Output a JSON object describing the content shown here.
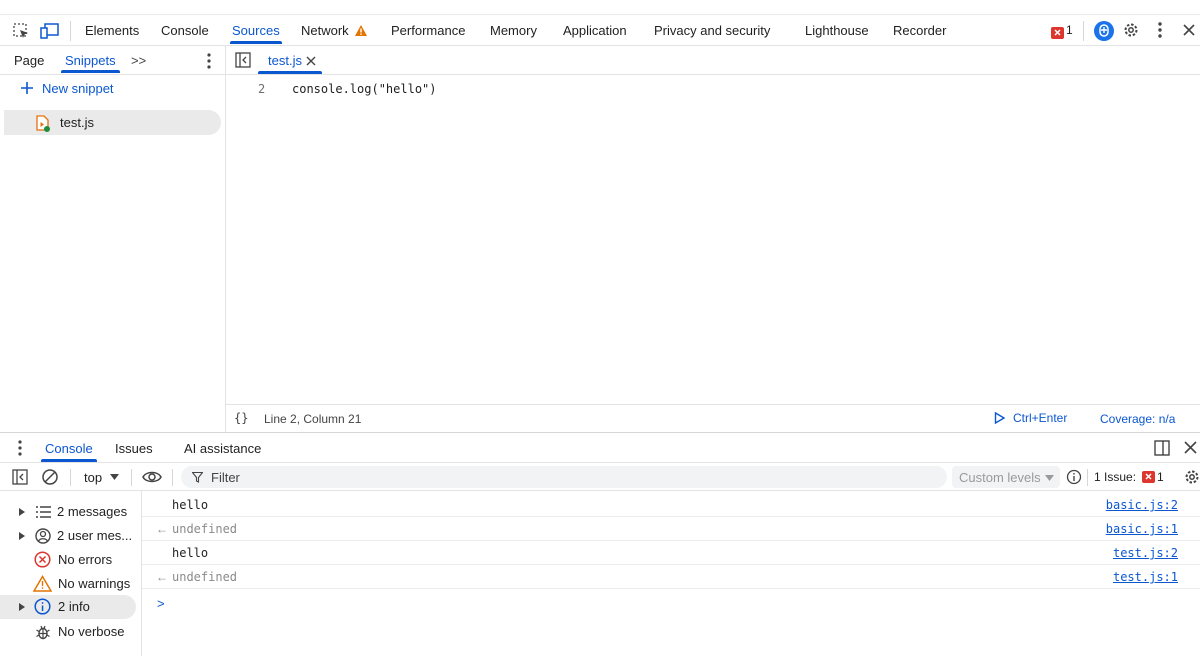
{
  "top_tabs": {
    "elements": "Elements",
    "console": "Console",
    "sources": "Sources",
    "network": "Network",
    "performance": "Performance",
    "memory": "Memory",
    "application": "Application",
    "privacy": "Privacy and security",
    "lighthouse": "Lighthouse",
    "recorder": "Recorder",
    "error_count": "1"
  },
  "navigator": {
    "tab_page": "Page",
    "tab_snippets": "Snippets",
    "more_tabs": ">>",
    "new_snippet": "New snippet",
    "file": "test.js"
  },
  "editor": {
    "tab_label": "test.js",
    "line_number": "2",
    "code": "console.log(\"hello\")",
    "cursor_position": "Line 2, Column 21",
    "run_label": "Ctrl+Enter",
    "coverage": "Coverage: n/a"
  },
  "drawer": {
    "tab_console": "Console",
    "tab_issues": "Issues",
    "tab_ai": "AI assistance"
  },
  "console_toolbar": {
    "context": "top",
    "filter_placeholder": "Filter",
    "levels": "Custom levels",
    "issues_label": "1 Issue:",
    "issues_count": "1"
  },
  "sidebar": {
    "messages": "2 messages",
    "user_messages": "2 user mes...",
    "errors": "No errors",
    "warnings": "No warnings",
    "info": "2 info",
    "verbose": "No verbose"
  },
  "messages": [
    {
      "text": "hello",
      "source": "basic.js:2"
    },
    {
      "text": "undefined",
      "source": "basic.js:1"
    },
    {
      "text": "hello",
      "source": "test.js:2"
    },
    {
      "text": "undefined",
      "source": "test.js:1"
    }
  ],
  "prompt": ">",
  "colors": {
    "accent": "#0b57d0",
    "error": "#dc362e",
    "warning": "#e37400"
  }
}
